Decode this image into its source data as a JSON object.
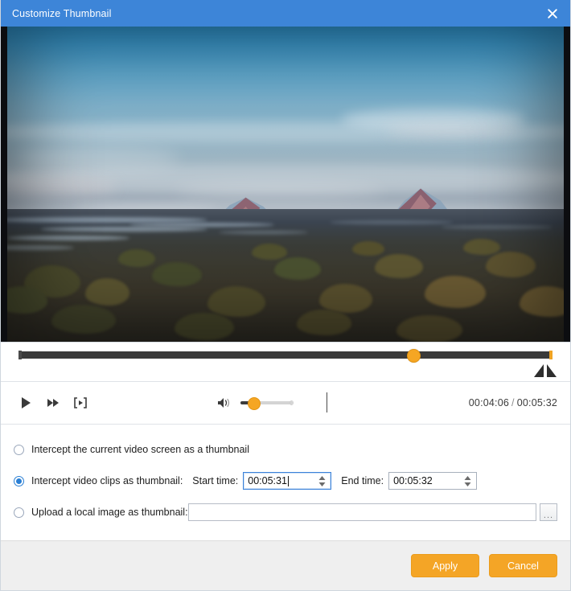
{
  "window": {
    "title": "Customize Thumbnail",
    "close_icon": "close-icon",
    "titlebar_color": "#3d85d8"
  },
  "player": {
    "timeline": {
      "position_percent": 74,
      "handle_icon": "timeline-handle",
      "trim_markers_icon": "clip-trim-markers-icon"
    },
    "controls": {
      "play_icon": "play-icon",
      "fast_forward_icon": "fast-forward-icon",
      "snapshot_icon": "frame-capture-icon",
      "speaker_icon": "volume-speaker-icon",
      "volume_percent": 25
    },
    "time": {
      "current": "00:04:06",
      "separator": "/",
      "total": "00:05:32"
    }
  },
  "options": {
    "option1": {
      "label": "Intercept the current video screen as a thumbnail",
      "selected": false
    },
    "option2": {
      "label": "Intercept video clips as thumbnail:",
      "selected": true,
      "start_label": "Start time:",
      "start_value": "00:05:31",
      "end_label": "End time:",
      "end_value": "00:05:32"
    },
    "option3": {
      "label": "Upload a local image as thumbnail:",
      "selected": false,
      "path_value": "",
      "path_placeholder": "",
      "browse_label": "..."
    }
  },
  "footer": {
    "apply_label": "Apply",
    "cancel_label": "Cancel",
    "button_color": "#f4a526"
  }
}
